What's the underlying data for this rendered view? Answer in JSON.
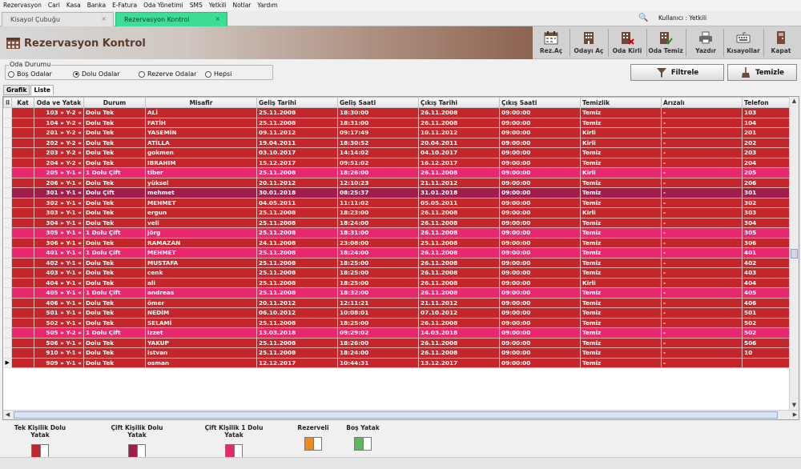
{
  "menu": [
    "Rezervasyon",
    "Cari",
    "Kasa",
    "Banka",
    "E-Fatura",
    "Oda Yönetimi",
    "SMS",
    "Yetkili",
    "Notlar",
    "Yardım"
  ],
  "tabs": [
    {
      "label": "Kisayol Çubuğu",
      "close": "×"
    },
    {
      "label": "Rezervasyon Kontrol",
      "close": "×"
    }
  ],
  "search_icon": "🔍",
  "user_label": "Kullanıcı : Yetkili",
  "page_title": "Rezervasyon Kontrol",
  "toolbar": [
    "Rez.Aç",
    "Odayı Aç",
    "Oda Kirli",
    "Oda Temiz",
    "Yazdır",
    "Kısayollar",
    "Kapat"
  ],
  "filter": {
    "group_label": "Oda Durumu",
    "options": [
      "Boş Odalar",
      "Dolu Odalar",
      "Rezerve Odalar",
      "Hepsi"
    ],
    "selected": "Dolu Odalar",
    "filter_button": "Filtrele",
    "clear_button": "Temizle"
  },
  "view_tabs": [
    "Grafik",
    "Liste"
  ],
  "grid": {
    "corner": "⠿",
    "columns": [
      "Kat",
      "Oda ve Yatak",
      "Durum",
      "Misafir",
      "Geliş Tarihi",
      "Geliş Saati",
      "Çıkış Tarihi",
      "Çıkış Saati",
      "Temizlik",
      "Arızalı",
      "Telefon"
    ],
    "rows": [
      {
        "type": "tek",
        "oda": "103 » Y-2 «",
        "durum": "Dolu Tek",
        "misafir": "ALİ",
        "gtarih": "25.11.2008",
        "gsaat": "18:30:00",
        "ctarih": "26.11.2008",
        "csaat": "09:00:00",
        "temizlik": "Temiz",
        "arizali": "-",
        "telefon": "103"
      },
      {
        "type": "tek",
        "oda": "104 » Y-2 «",
        "durum": "Dolu Tek",
        "misafir": "FATİH",
        "gtarih": "25.11.2008",
        "gsaat": "18:31:00",
        "ctarih": "26.11.2008",
        "csaat": "09:00:00",
        "temizlik": "Temiz",
        "arizali": "-",
        "telefon": "104"
      },
      {
        "type": "tek",
        "oda": "201 » Y-2 «",
        "durum": "Dolu Tek",
        "misafir": "YASEMİN",
        "gtarih": "09.11.2012",
        "gsaat": "09:17:49",
        "ctarih": "10.11.2012",
        "csaat": "09:00:00",
        "temizlik": "Kirli",
        "arizali": "-",
        "telefon": "201"
      },
      {
        "type": "tek",
        "oda": "202 » Y-2 «",
        "durum": "Dolu Tek",
        "misafir": "ATİLLA",
        "gtarih": "19.04.2011",
        "gsaat": "18:30:52",
        "ctarih": "20.04.2011",
        "csaat": "09:00:00",
        "temizlik": "Kirli",
        "arizali": "-",
        "telefon": "202"
      },
      {
        "type": "tek",
        "oda": "203 » Y-2 «",
        "durum": "Dolu Tek",
        "misafir": "gokmen",
        "gtarih": "03.10.2017",
        "gsaat": "14:14:02",
        "ctarih": "04.10.2017",
        "csaat": "09:00:00",
        "temizlik": "Temiz",
        "arizali": "-",
        "telefon": "203"
      },
      {
        "type": "tek",
        "oda": "204 » Y-2 «",
        "durum": "Dolu Tek",
        "misafir": "IBRAHIM",
        "gtarih": "15.12.2017",
        "gsaat": "09:51:02",
        "ctarih": "16.12.2017",
        "csaat": "09:00:00",
        "temizlik": "Temiz",
        "arizali": "-",
        "telefon": "204"
      },
      {
        "type": "cift1",
        "oda": "205 » Y-1 «",
        "durum": "1 Dolu Çift",
        "misafir": "tiber",
        "gtarih": "25.11.2008",
        "gsaat": "18:26:00",
        "ctarih": "26.11.2008",
        "csaat": "09:00:00",
        "temizlik": "Kirli",
        "arizali": "-",
        "telefon": "205"
      },
      {
        "type": "tek",
        "oda": "206 » Y-1 «",
        "durum": "Dolu Tek",
        "misafir": "yüksel",
        "gtarih": "20.11.2012",
        "gsaat": "12:10:23",
        "ctarih": "21.11.2012",
        "csaat": "09:00:00",
        "temizlik": "Temiz",
        "arizali": "-",
        "telefon": "206"
      },
      {
        "type": "cift",
        "oda": "301 » Y-1 «",
        "durum": "Dolu Çift",
        "misafir": "mehmet",
        "gtarih": "30.01.2018",
        "gsaat": "08:25:37",
        "ctarih": "31.01.2018",
        "csaat": "09:00:00",
        "temizlik": "Temiz",
        "arizali": "-",
        "telefon": "301"
      },
      {
        "type": "tek",
        "oda": "302 » Y-1 «",
        "durum": "Dolu Tek",
        "misafir": "MEHMET",
        "gtarih": "04.05.2011",
        "gsaat": "11:11:02",
        "ctarih": "05.05.2011",
        "csaat": "09:00:00",
        "temizlik": "Temiz",
        "arizali": "-",
        "telefon": "302"
      },
      {
        "type": "tek",
        "oda": "303 » Y-1 «",
        "durum": "Dolu Tek",
        "misafir": "ergun",
        "gtarih": "25.11.2008",
        "gsaat": "18:23:00",
        "ctarih": "26.11.2008",
        "csaat": "09:00:00",
        "temizlik": "Kirli",
        "arizali": "-",
        "telefon": "303"
      },
      {
        "type": "tek",
        "oda": "304 » Y-1 «",
        "durum": "Dolu Tek",
        "misafir": "veli",
        "gtarih": "25.11.2008",
        "gsaat": "18:24:00",
        "ctarih": "26.11.2008",
        "csaat": "09:00:00",
        "temizlik": "Temiz",
        "arizali": "-",
        "telefon": "304"
      },
      {
        "type": "cift1",
        "oda": "305 » Y-1 «",
        "durum": "1 Dolu Çift",
        "misafir": "jörg",
        "gtarih": "25.11.2008",
        "gsaat": "18:31:00",
        "ctarih": "26.11.2008",
        "csaat": "09:00:00",
        "temizlik": "Temiz",
        "arizali": "-",
        "telefon": "305"
      },
      {
        "type": "tek",
        "oda": "306 » Y-1 «",
        "durum": "Dolu Tek",
        "misafir": "RAMAZAN",
        "gtarih": "24.11.2008",
        "gsaat": "23:08:00",
        "ctarih": "25.11.2008",
        "csaat": "09:00:00",
        "temizlik": "Temiz",
        "arizali": "-",
        "telefon": "306"
      },
      {
        "type": "cift1",
        "oda": "401 » Y-1 «",
        "durum": "1 Dolu Çift",
        "misafir": "MEHMET",
        "gtarih": "25.11.2008",
        "gsaat": "18:24:00",
        "ctarih": "26.11.2008",
        "csaat": "09:00:00",
        "temizlik": "Temiz",
        "arizali": "-",
        "telefon": "401"
      },
      {
        "type": "tek",
        "oda": "402 » Y-1 «",
        "durum": "Dolu Tek",
        "misafir": "MUSTAFA",
        "gtarih": "25.11.2008",
        "gsaat": "18:25:00",
        "ctarih": "26.11.2008",
        "csaat": "09:00:00",
        "temizlik": "Temiz",
        "arizali": "-",
        "telefon": "402"
      },
      {
        "type": "tek",
        "oda": "403 » Y-1 «",
        "durum": "Dolu Tek",
        "misafir": "cenk",
        "gtarih": "25.11.2008",
        "gsaat": "18:25:00",
        "ctarih": "26.11.2008",
        "csaat": "09:00:00",
        "temizlik": "Temiz",
        "arizali": "-",
        "telefon": "403"
      },
      {
        "type": "tek",
        "oda": "404 » Y-1 «",
        "durum": "Dolu Tek",
        "misafir": "ali",
        "gtarih": "25.11.2008",
        "gsaat": "18:25:00",
        "ctarih": "26.11.2008",
        "csaat": "09:00:00",
        "temizlik": "Kirli",
        "arizali": "-",
        "telefon": "404"
      },
      {
        "type": "cift1",
        "oda": "405 » Y-1 «",
        "durum": "1 Dolu Çift",
        "misafir": "andreas",
        "gtarih": "25.11.2008",
        "gsaat": "18:32:00",
        "ctarih": "26.11.2008",
        "csaat": "09:00:00",
        "temizlik": "Temiz",
        "arizali": "-",
        "telefon": "405"
      },
      {
        "type": "tek",
        "oda": "406 » Y-1 «",
        "durum": "Dolu Tek",
        "misafir": "ömer",
        "gtarih": "20.11.2012",
        "gsaat": "12:11:21",
        "ctarih": "21.11.2012",
        "csaat": "09:00:00",
        "temizlik": "Temiz",
        "arizali": "-",
        "telefon": "406"
      },
      {
        "type": "tek",
        "oda": "501 » Y-1 «",
        "durum": "Dolu Tek",
        "misafir": "NEDİM",
        "gtarih": "06.10.2012",
        "gsaat": "10:08:01",
        "ctarih": "07.10.2012",
        "csaat": "09:00:00",
        "temizlik": "Temiz",
        "arizali": "-",
        "telefon": "501"
      },
      {
        "type": "tek",
        "oda": "502 » Y-1 «",
        "durum": "Dolu Tek",
        "misafir": "SELAMİ",
        "gtarih": "25.11.2008",
        "gsaat": "18:25:00",
        "ctarih": "26.11.2008",
        "csaat": "09:00:00",
        "temizlik": "Temiz",
        "arizali": "-",
        "telefon": "502"
      },
      {
        "type": "cift1",
        "oda": "505 » Y-2 «",
        "durum": "1 Dolu Çift",
        "misafir": "izzet",
        "gtarih": "13.03.2018",
        "gsaat": "09:29:02",
        "ctarih": "14.03.2018",
        "csaat": "09:00:00",
        "temizlik": "Temiz",
        "arizali": "-",
        "telefon": "502"
      },
      {
        "type": "tek",
        "oda": "506 » Y-1 «",
        "durum": "Dolu Tek",
        "misafir": "YAKUP",
        "gtarih": "25.11.2008",
        "gsaat": "18:26:00",
        "ctarih": "26.11.2008",
        "csaat": "09:00:00",
        "temizlik": "Temiz",
        "arizali": "-",
        "telefon": "506"
      },
      {
        "type": "tek",
        "oda": "910 » Y-1 «",
        "durum": "Dolu Tek",
        "misafir": "istvan",
        "gtarih": "25.11.2008",
        "gsaat": "18:24:00",
        "ctarih": "26.11.2008",
        "csaat": "09:00:00",
        "temizlik": "Temiz",
        "arizali": "-",
        "telefon": "10"
      },
      {
        "type": "tek",
        "oda": "909 » Y-1 «",
        "durum": "Dolu Tek",
        "misafir": "osman",
        "gtarih": "12.12.2017",
        "gsaat": "10:44:31",
        "ctarih": "13.12.2017",
        "csaat": "09:00:00",
        "temizlik": "Temiz",
        "arizali": "-",
        "telefon": "",
        "current": true
      }
    ]
  },
  "legend": [
    {
      "label": "Tek Kişilik Dolu Yatak",
      "color": "#c3272b"
    },
    {
      "label": "Çift Kişilik Dolu Yatak",
      "color": "#a31d4b"
    },
    {
      "label": "Çift Kişilik 1 Dolu Yatak",
      "color": "#e8286d"
    },
    {
      "label": "Rezerveli",
      "color": "#f08a1c"
    },
    {
      "label": "Boş Yatak",
      "color": "#5cb85c"
    }
  ],
  "colors": {
    "tek": "#c3272b",
    "cift": "#a31d4b",
    "cift1": "#e8286d",
    "active_tab": "#3cde97"
  },
  "icons": {
    "toolbar": [
      "calendar-icon",
      "building-icon",
      "building-dirty-icon",
      "building-clean-icon",
      "printer-icon",
      "keyboard-icon",
      "exit-icon"
    ],
    "filter": "funnel-icon",
    "clear": "broom-icon",
    "current_row": "▶",
    "scroll_up": "▲",
    "scroll_down": "▼",
    "scroll_left": "◀",
    "scroll_right": "▶"
  }
}
